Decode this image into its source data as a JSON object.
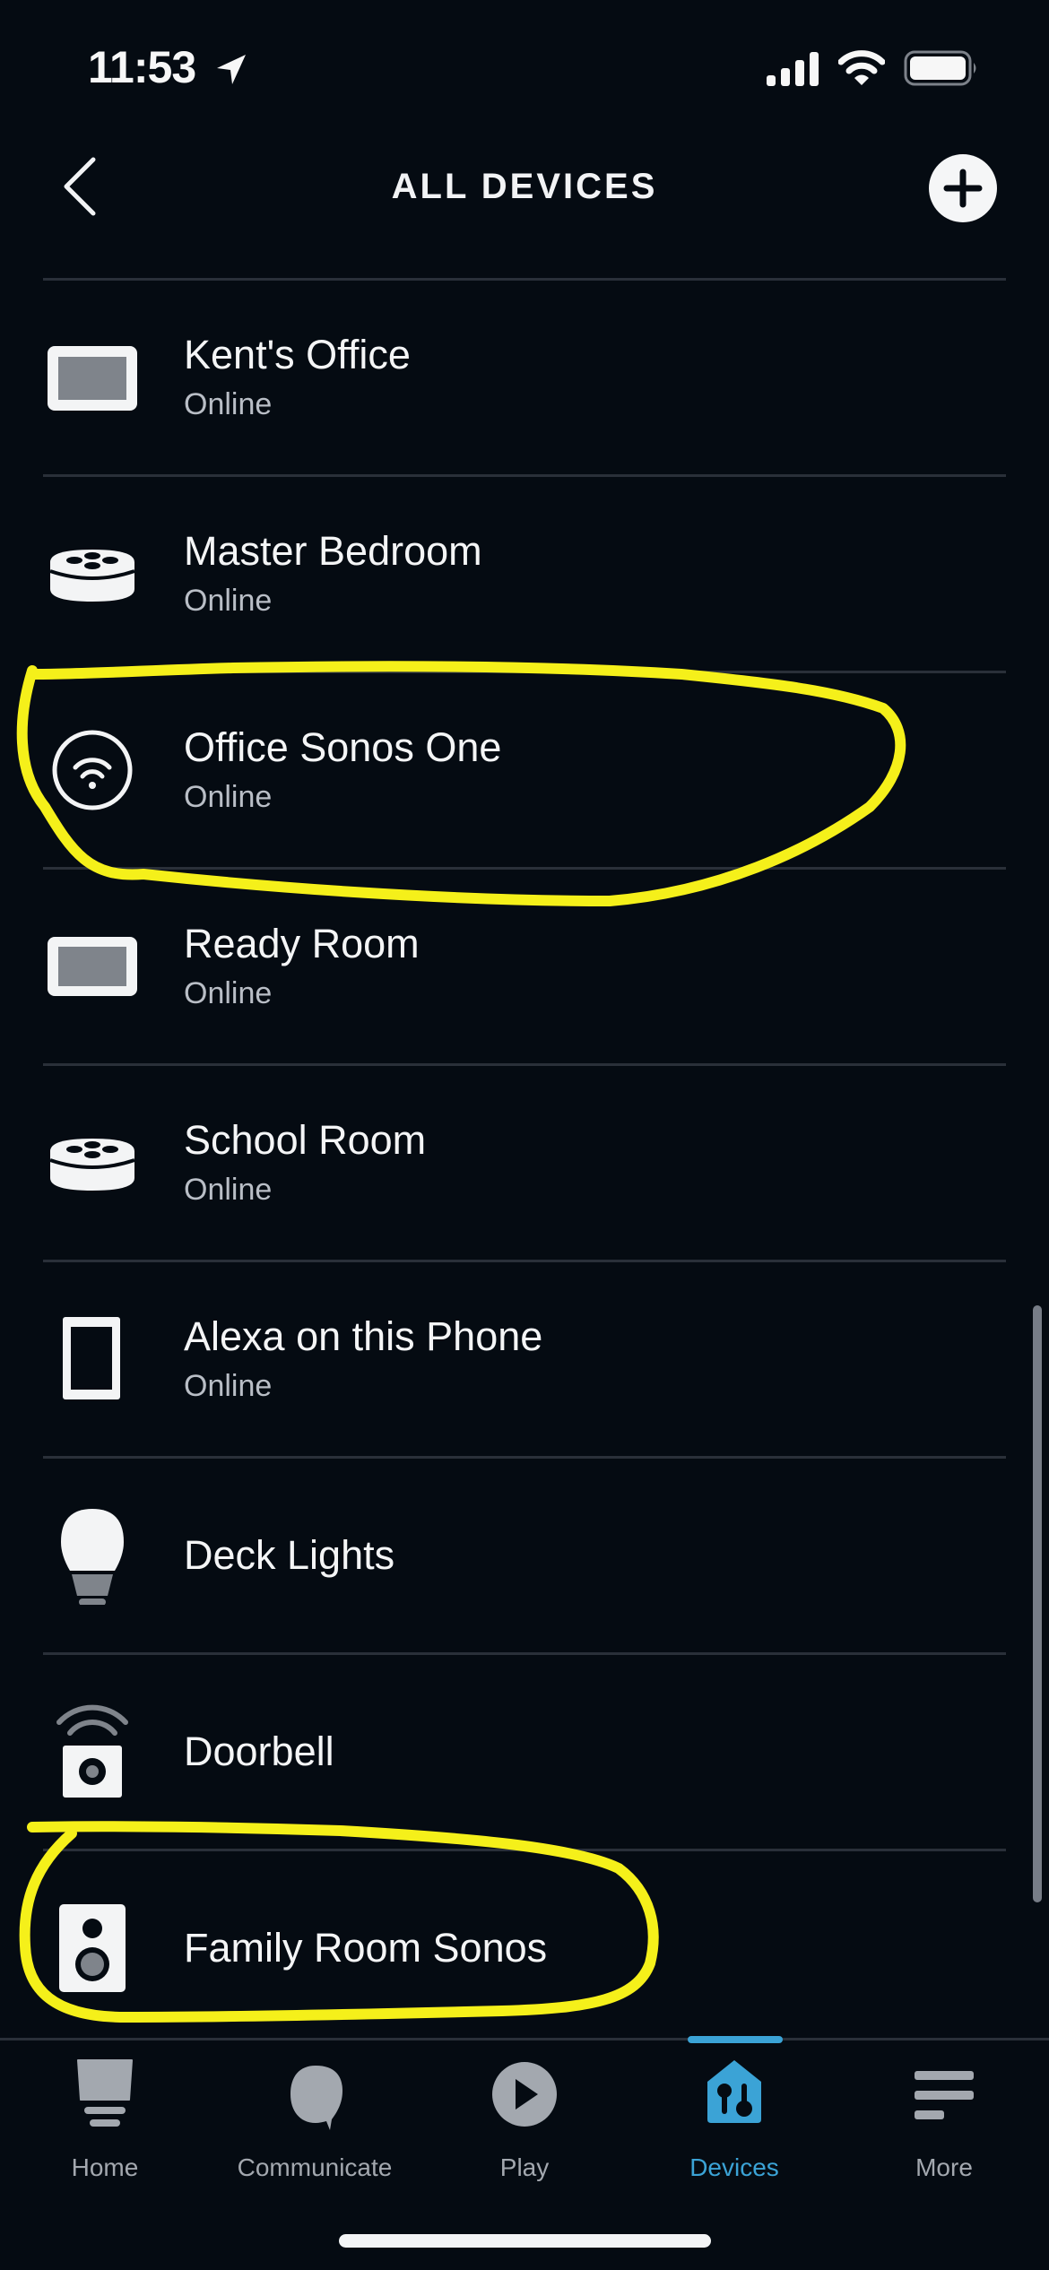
{
  "status_bar": {
    "time": "11:53",
    "icons": [
      "location-arrow-icon",
      "cellular-signal-icon",
      "wifi-icon",
      "battery-icon"
    ]
  },
  "header": {
    "title": "ALL DEVICES",
    "back_icon": "chevron-left-icon",
    "add_icon": "plus-circle-icon"
  },
  "devices": [
    {
      "name": "Kent's Office",
      "status": "Online",
      "icon": "echo-show-icon"
    },
    {
      "name": "Master Bedroom",
      "status": "Online",
      "icon": "echo-dot-icon"
    },
    {
      "name": "Office Sonos One",
      "status": "Online",
      "icon": "wifi-speaker-icon",
      "highlighted": true
    },
    {
      "name": "Ready Room",
      "status": "Online",
      "icon": "echo-show-icon"
    },
    {
      "name": "School Room",
      "status": "Online",
      "icon": "echo-dot-icon"
    },
    {
      "name": "Alexa on this Phone",
      "status": "Online",
      "icon": "phone-icon"
    },
    {
      "name": "Deck Lights",
      "status": "",
      "icon": "light-bulb-icon"
    },
    {
      "name": "Doorbell",
      "status": "",
      "icon": "doorbell-icon"
    },
    {
      "name": "Family Room Sonos",
      "status": "",
      "icon": "speaker-icon",
      "highlighted": true
    }
  ],
  "bottom_nav": {
    "active": "Devices",
    "items": [
      {
        "label": "Home",
        "icon": "home-icon"
      },
      {
        "label": "Communicate",
        "icon": "chat-bubble-icon"
      },
      {
        "label": "Play",
        "icon": "play-icon"
      },
      {
        "label": "Devices",
        "icon": "devices-house-icon"
      },
      {
        "label": "More",
        "icon": "menu-icon"
      }
    ]
  },
  "colors": {
    "background": "#050b12",
    "divider": "#2a3039",
    "accent": "#3ba3d6",
    "inactive_nav": "#a3a8af",
    "annotation": "#f5f01a"
  }
}
